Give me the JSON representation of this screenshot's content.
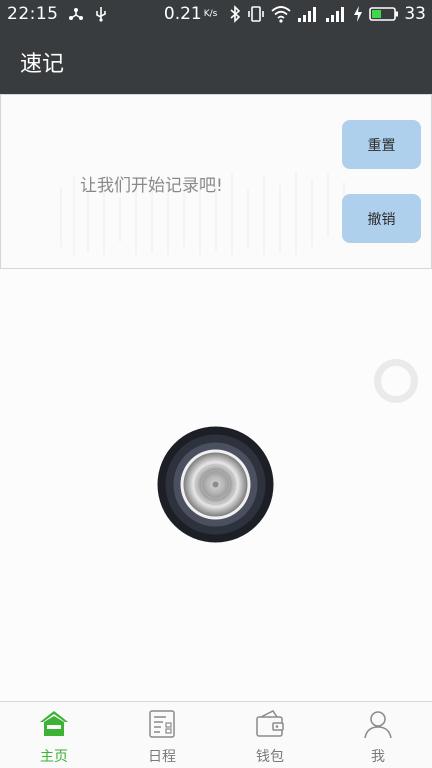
{
  "status_bar": {
    "time": "22:15",
    "net_speed": "0.21",
    "net_unit": "K/s",
    "battery_level": "33",
    "left_icons": [
      "share-icon",
      "usb-icon"
    ],
    "right_icons": [
      "bluetooth-icon",
      "vibrate-icon",
      "wifi-icon",
      "signal-icon",
      "signal-icon",
      "charging-icon",
      "battery-icon"
    ]
  },
  "app_bar": {
    "title": "速记"
  },
  "record_panel": {
    "hint": "让我们开始记录吧!",
    "reset_label": "重置",
    "undo_label": "撤销",
    "button_color": "#aed0ec"
  },
  "main": {
    "record_knob_icon": "record-knob-icon",
    "side_ring_icon": "ring-icon"
  },
  "bottom_nav": {
    "active_color": "#3db234",
    "items": [
      {
        "label": "主页",
        "icon": "home-icon",
        "active": true
      },
      {
        "label": "日程",
        "icon": "schedule-icon",
        "active": false
      },
      {
        "label": "钱包",
        "icon": "wallet-icon",
        "active": false
      },
      {
        "label": "我",
        "icon": "profile-icon",
        "active": false
      }
    ]
  },
  "colors": {
    "header_bg": "#383c3e",
    "page_bg": "#fcfcfc",
    "hint_text": "#8a8a8a"
  }
}
